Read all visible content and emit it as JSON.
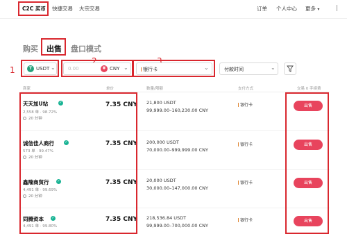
{
  "nav": {
    "c2c": "C2C 买币",
    "express": "快捷交易",
    "block": "大宗交易",
    "orders": "订单",
    "profile": "个人中心",
    "more": "更多"
  },
  "tabs": {
    "buy": "购买",
    "sell": "出售",
    "mode": "盘口模式"
  },
  "markers": {
    "one": "1",
    "two": "2",
    "three": "3"
  },
  "filters": {
    "coin": "USDT",
    "coin_icon": "T",
    "amount_placeholder": "0.00",
    "fiat": "CNY",
    "fiat_icon": "¥",
    "payment": "银行卡",
    "pay_time": "付款时间"
  },
  "table": {
    "headers": {
      "merchant": "商家",
      "price": "单价",
      "qty_limit": "数量/限额",
      "payment": "支付方式",
      "trade": "交易 0 手续费"
    },
    "rows": [
      {
        "name": "天天加U站",
        "stats": "2,558 单 · 98.72%",
        "time": "20 分钟",
        "price": "7.35 CNY",
        "qty": "21,800 USDT",
        "limit": "99,999.00–160,230.00 CNY",
        "payment": "银行卡",
        "action": "出售"
      },
      {
        "name": "诚信佳人商行",
        "stats": "573 单 · 99.47%",
        "time": "20 分钟",
        "price": "7.35 CNY",
        "qty": "200,000 USDT",
        "limit": "70,000.00–999,999.00 CNY",
        "payment": "银行卡",
        "action": "出售"
      },
      {
        "name": "鑫隆商贸行",
        "stats": "4,491 单 · 99.69%",
        "time": "20 分钟",
        "price": "7.35 CNY",
        "qty": "20,000 USDT",
        "limit": "30,000.00–147,000.00 CNY",
        "payment": "银行卡",
        "action": "出售"
      },
      {
        "name": "同腾资本",
        "stats": "4,491 单 · 99.80%",
        "time": "20 分钟",
        "price": "7.35 CNY",
        "qty": "218,536.84 USDT",
        "limit": "99,999.00–700,000.00 CNY",
        "payment": "银行卡",
        "action": "出售"
      }
    ]
  },
  "colors": {
    "accent_red": "#d9272e",
    "sell_button": "#e8445d",
    "verified": "#19b394",
    "coin_usdt": "#26a17b",
    "coin_cny": "#e8445d"
  }
}
